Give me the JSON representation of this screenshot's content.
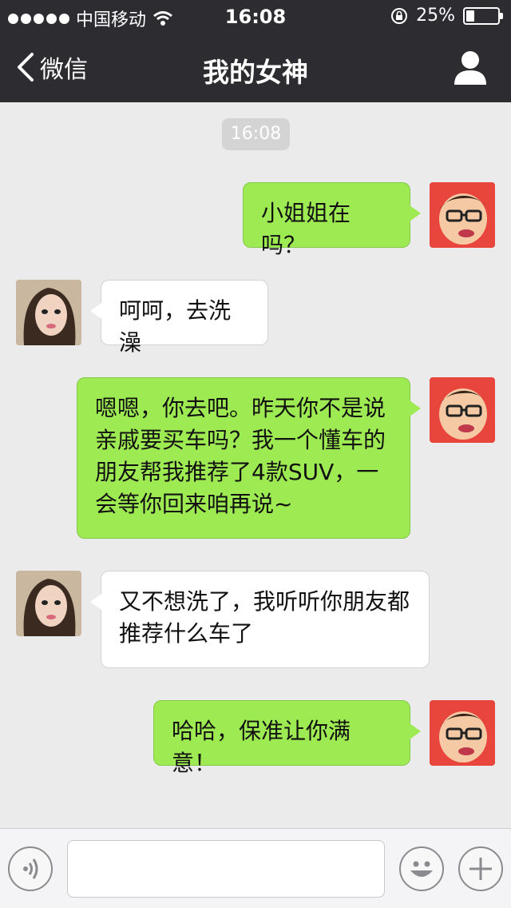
{
  "status_bar": {
    "carrier": "中国移动",
    "time": "16:08",
    "battery": "25%",
    "battery_level": 0.25
  },
  "nav": {
    "back_label": "微信",
    "title": "我的女神"
  },
  "chat": {
    "timestamp": "16:08",
    "messages": [
      {
        "side": "out",
        "text": "小姐姐在吗？"
      },
      {
        "side": "in",
        "text": "呵呵，去洗澡"
      },
      {
        "side": "out",
        "text": "嗯嗯，你去吧。昨天你不是说\n亲戚要买车吗？我一个懂车的\n朋友帮我推荐了4款SUV，一\n会等你回来咱再说~"
      },
      {
        "side": "in",
        "text": "又不想洗了，我听听你朋友都\n推荐什么车了"
      },
      {
        "side": "out",
        "text": "哈哈，保准让你满意！"
      }
    ]
  },
  "input": {
    "placeholder": ""
  },
  "colors": {
    "bar_bg": "#2d2d31",
    "chat_bg": "#ebebeb",
    "out_bubble": "#9eea52",
    "in_bubble": "#ffffff"
  }
}
